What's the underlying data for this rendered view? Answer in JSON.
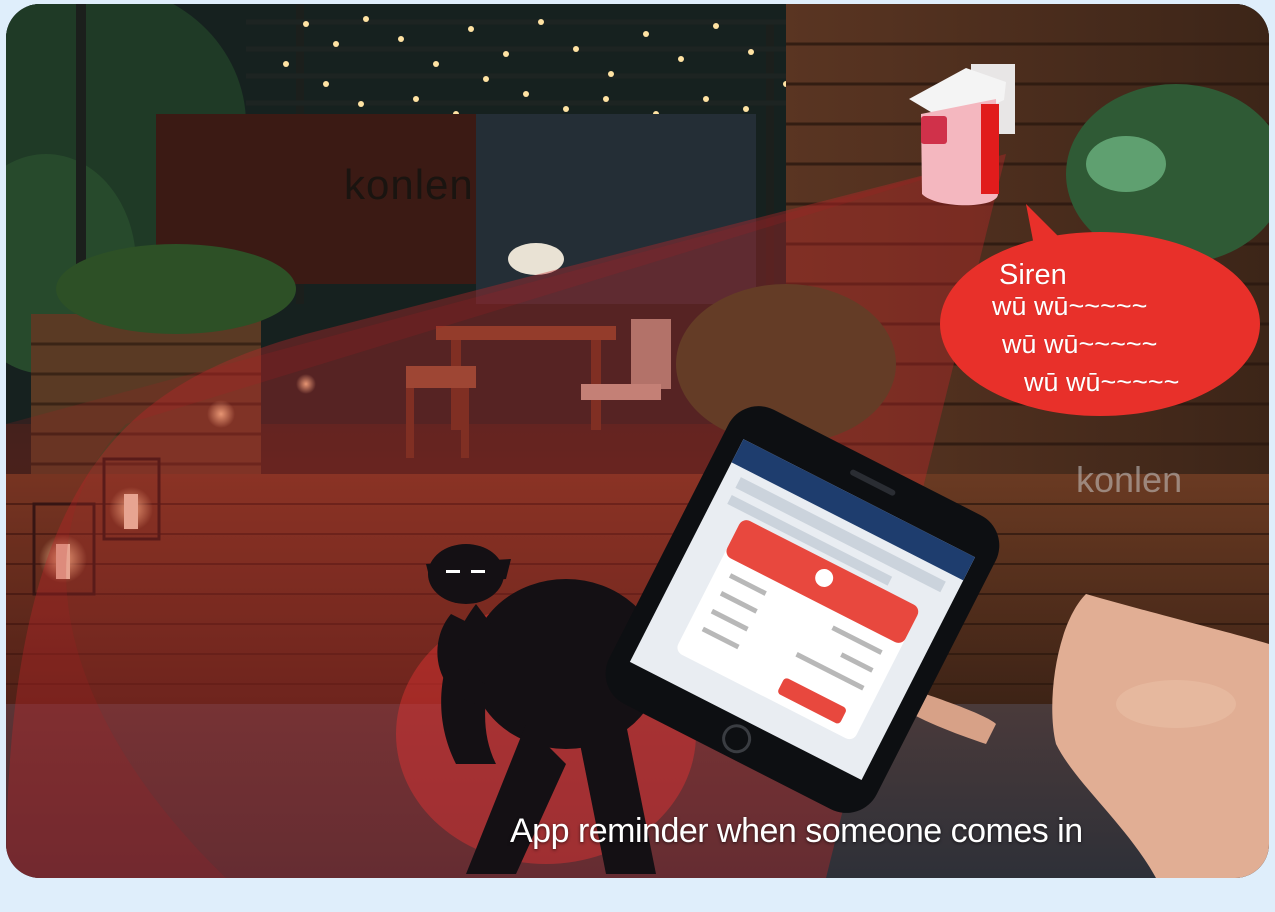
{
  "watermark": "konlen",
  "bubble": {
    "title": "Siren",
    "lines": [
      "wū wū~~~~~",
      "wū wū~~~~~",
      "wū wū~~~~~"
    ]
  },
  "caption": "App reminder when someone comes in",
  "colors": {
    "background": "#dfeefb",
    "alert_red": "#e8302a",
    "red_overlay": "#c0282a"
  },
  "icons": [
    "siren-device-icon",
    "intruder-silhouette-icon",
    "smartphone-icon",
    "hand-icon",
    "bell-icon"
  ]
}
